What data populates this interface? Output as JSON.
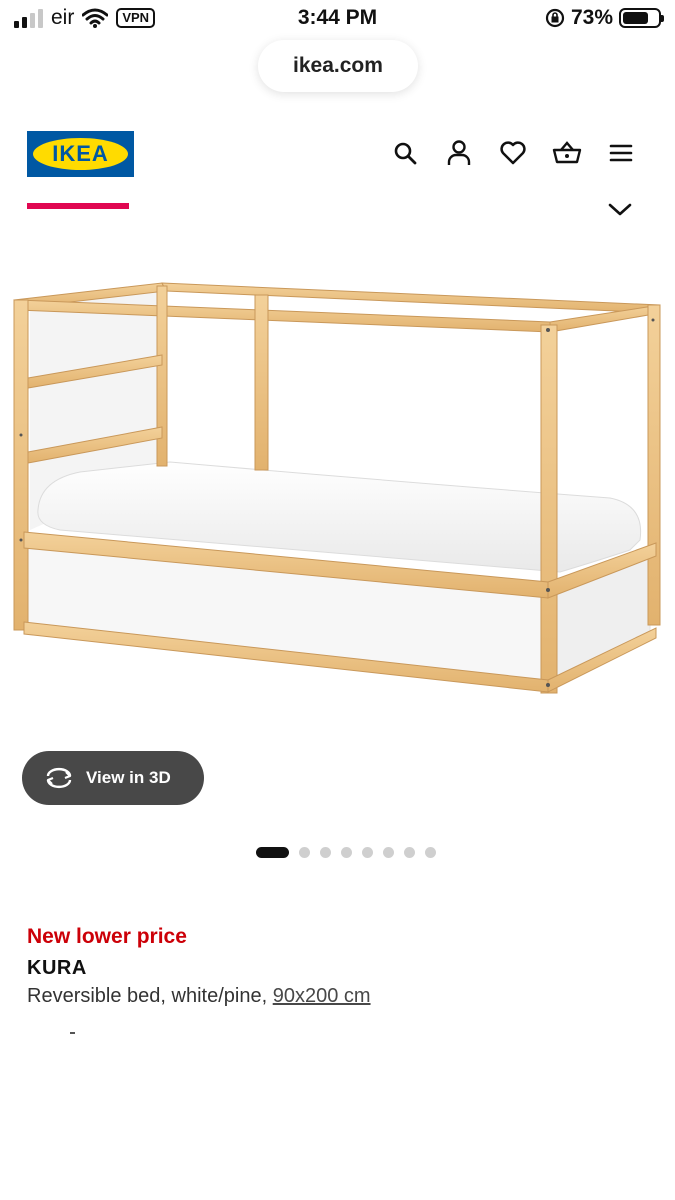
{
  "status_bar": {
    "carrier": "eir",
    "vpn": "VPN",
    "time": "3:44 PM",
    "battery_percent": "73%",
    "battery_level": 0.73
  },
  "browser": {
    "url": "ikea.com"
  },
  "header": {
    "logo_text": "IKEA",
    "icons": [
      "search-icon",
      "account-icon",
      "heart-icon",
      "basket-icon",
      "menu-icon"
    ]
  },
  "gallery": {
    "view3d_label": "View in 3D",
    "dot_count": 8,
    "active_dot": 0
  },
  "product": {
    "promo": "New lower price",
    "name": "KURA",
    "description": "Reversible bed, white/pine,",
    "size_link": "90x200 cm"
  },
  "colors": {
    "brand_blue": "#0058a3",
    "brand_yellow": "#ffdb00",
    "accent_red": "#cc0008",
    "underline_pink": "#e00751"
  }
}
